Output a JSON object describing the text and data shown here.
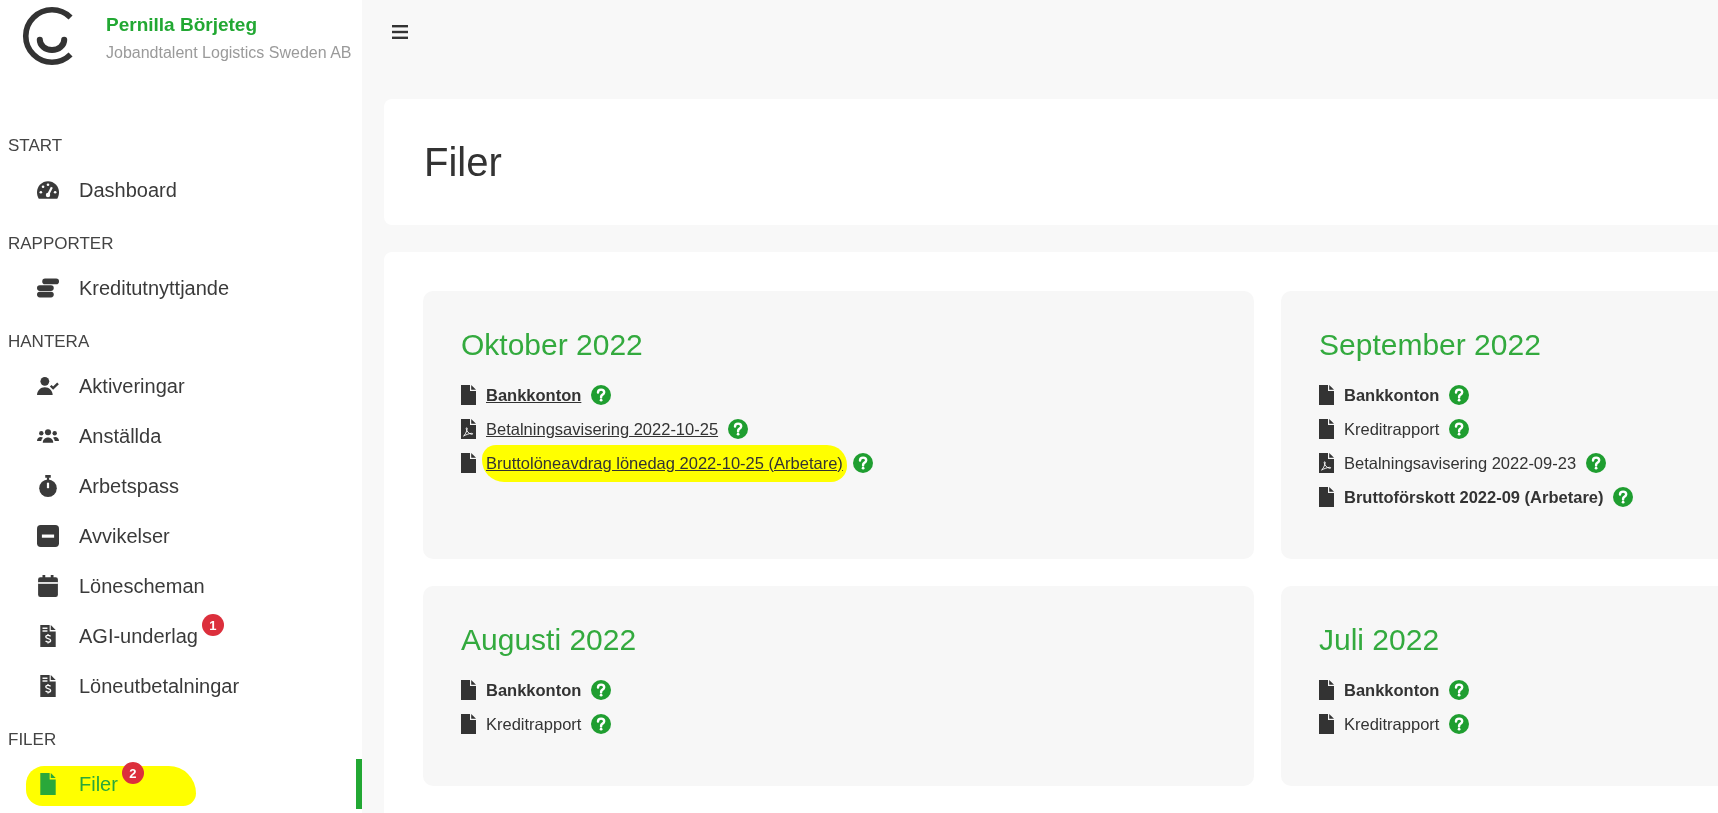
{
  "sidebar": {
    "user_name": "Pernilla Börjeteg",
    "company": "Jobandtalent Logistics Sweden AB",
    "sections": [
      {
        "title": "START",
        "items": [
          {
            "label": "Dashboard",
            "selected": false,
            "highlighted": false
          }
        ]
      },
      {
        "title": "RAPPORTER",
        "items": [
          {
            "label": "Kreditutnyttjande",
            "selected": false,
            "highlighted": false
          }
        ]
      },
      {
        "title": "HANTERA",
        "items": [
          {
            "label": "Aktiveringar",
            "selected": false,
            "highlighted": false
          },
          {
            "label": "Anställda",
            "selected": false,
            "highlighted": false
          },
          {
            "label": "Arbetspass",
            "selected": false,
            "highlighted": false
          },
          {
            "label": "Avvikelser",
            "selected": false,
            "highlighted": false
          },
          {
            "label": "Lönescheman",
            "selected": false,
            "highlighted": false
          },
          {
            "label": "AGI-underlag",
            "badge": "1",
            "selected": false,
            "highlighted": false
          },
          {
            "label": "Löneutbetalningar",
            "selected": false,
            "highlighted": false
          }
        ]
      },
      {
        "title": "FILER",
        "items": [
          {
            "label": "Filer",
            "badge": "2",
            "selected": true,
            "highlighted": true
          }
        ]
      }
    ]
  },
  "page_title": "Filer",
  "months": [
    {
      "title": "Oktober 2022",
      "files": [
        {
          "kind": "file",
          "label": "Bankkonton",
          "unread": true,
          "underlined": true,
          "highlighted": false
        },
        {
          "kind": "pdf",
          "label": "Betalningsavisering 2022-10-25",
          "unread": false,
          "underlined": true,
          "highlighted": false
        },
        {
          "kind": "file",
          "label": "Bruttolöneavdrag lönedag 2022-10-25 (Arbetare)",
          "unread": false,
          "underlined": true,
          "highlighted": true
        }
      ]
    },
    {
      "title": "September 2022",
      "files": [
        {
          "kind": "file",
          "label": "Bankkonton",
          "unread": true,
          "underlined": false,
          "highlighted": false
        },
        {
          "kind": "file",
          "label": "Kreditrapport",
          "unread": false,
          "underlined": false,
          "highlighted": false
        },
        {
          "kind": "pdf",
          "label": "Betalningsavisering 2022-09-23",
          "unread": false,
          "underlined": false,
          "highlighted": false
        },
        {
          "kind": "file",
          "label": "Bruttoförskott 2022-09 (Arbetare)",
          "unread": true,
          "underlined": false,
          "highlighted": false
        }
      ]
    },
    {
      "title": "Augusti 2022",
      "files": [
        {
          "kind": "file",
          "label": "Bankkonton",
          "unread": true,
          "underlined": false,
          "highlighted": false
        },
        {
          "kind": "file",
          "label": "Kreditrapport",
          "unread": false,
          "underlined": false,
          "highlighted": false
        }
      ]
    },
    {
      "title": "Juli 2022",
      "files": [
        {
          "kind": "file",
          "label": "Bankkonton",
          "unread": true,
          "underlined": false,
          "highlighted": false
        },
        {
          "kind": "file",
          "label": "Kreditrapport",
          "unread": false,
          "underlined": false,
          "highlighted": false
        }
      ]
    }
  ]
}
